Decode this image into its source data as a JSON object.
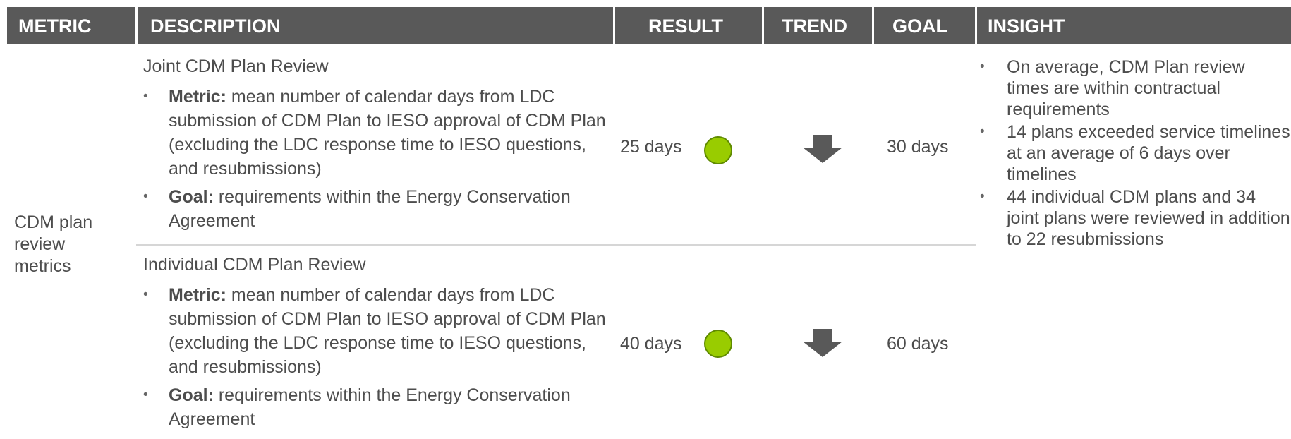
{
  "header": {
    "metric": "METRIC",
    "description": "DESCRIPTION",
    "result": "RESULT",
    "trend": "TREND",
    "goal": "GOAL",
    "insight": "INSIGHT"
  },
  "metric_label": "CDM plan\nreview\nmetrics",
  "rows": [
    {
      "title": "Joint CDM Plan Review",
      "metric_bold": "Metric:",
      "metric_text": " mean number of calendar days from LDC submission of CDM Plan to IESO approval of CDM Plan (excluding the LDC response time to IESO questions, and resubmissions)",
      "goal_bold": "Goal:",
      "goal_text": " requirements within the Energy Conservation Agreement",
      "result": "25 days",
      "status_color": "#99cc00",
      "trend_icon": "arrow-down-icon",
      "goal": "30 days"
    },
    {
      "title": "Individual CDM Plan Review",
      "metric_bold": "Metric:",
      "metric_text": " mean number of calendar days from LDC submission of CDM Plan to IESO approval of CDM Plan (excluding the LDC response time to IESO questions, and resubmissions)",
      "goal_bold": "Goal:",
      "goal_text": " requirements within the Energy Conservation Agreement",
      "result": "40 days",
      "status_color": "#99cc00",
      "trend_icon": "arrow-down-icon",
      "goal": "60 days"
    }
  ],
  "insights": [
    "On average, CDM Plan review times are within contractual requirements",
    "14 plans exceeded service timelines at an average of 6 days over timelines",
    "44 individual CDM plans and 34 joint plans were reviewed in addition to 22 resubmissions"
  ]
}
